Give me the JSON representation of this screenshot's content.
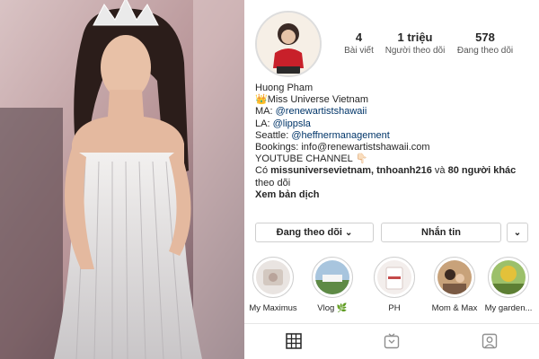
{
  "profile": {
    "stats": {
      "posts": {
        "value": "4",
        "label": "Bài viết"
      },
      "followers": {
        "value": "1 triệu",
        "label": "Người theo dõi"
      },
      "following": {
        "value": "578",
        "label": "Đang theo dõi"
      }
    },
    "name": "Huong Pham",
    "bio": {
      "crown_emoji": "👑",
      "line1": "Miss Universe Vietnam",
      "ma_prefix": "MA: ",
      "ma_handle": "@renewartistshawaii",
      "la_prefix": "LA: ",
      "la_handle": "@lippsla",
      "seattle_prefix": "Seattle: ",
      "seattle_handle": "@heffnermanagement",
      "bookings": "Bookings:  info@renewartistshawaii.com",
      "youtube": "YOUTUBE CHANNEL ",
      "point_emoji": "👇🏻"
    },
    "followed_by": {
      "prefix": "Có ",
      "names": "missuniversevietnam, tnhoanh216",
      "middle": " và ",
      "others": "80 người khác",
      "suffix": "theo dõi"
    },
    "translate": "Xem bản dịch"
  },
  "actions": {
    "following_label": "Đang theo dõi",
    "following_chevron": "⌄",
    "message_label": "Nhắn tin",
    "more_chevron": "⌄"
  },
  "highlights": [
    {
      "label": "My Maximus"
    },
    {
      "label": "Vlog",
      "emoji": "🌿"
    },
    {
      "label": "PH"
    },
    {
      "label": "Mom & Max"
    },
    {
      "label": "My garden..."
    }
  ],
  "tabs": [
    {
      "icon": "grid-icon"
    },
    {
      "icon": "igtv-icon"
    },
    {
      "icon": "tagged-icon"
    }
  ],
  "colors": {
    "link": "#003569",
    "text": "#262626",
    "border": "#cfcfcf"
  }
}
